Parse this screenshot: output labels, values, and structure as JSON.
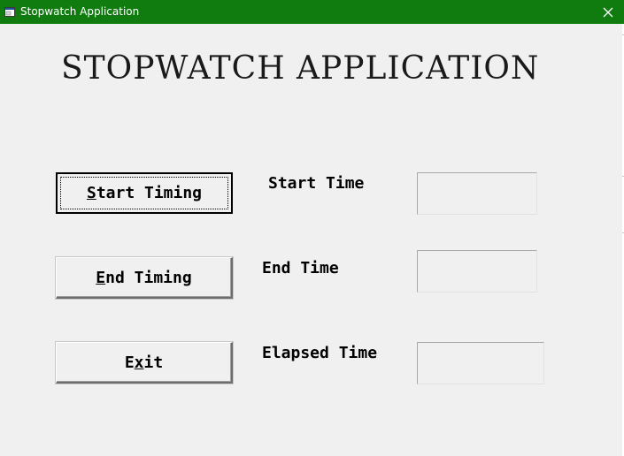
{
  "window": {
    "title": "Stopwatch Application",
    "titlebar_color": "#107c10",
    "icon": "app-window-icon",
    "close_icon": "close-icon"
  },
  "heading": "STOPWATCH APPLICATION",
  "buttons": {
    "start": {
      "label_access_key": "S",
      "label_rest": "tart Timing"
    },
    "end": {
      "label_access_key": "E",
      "label_rest": "nd Timing"
    },
    "exit": {
      "label_before": "E",
      "label_access_key": "x",
      "label_after": "it"
    }
  },
  "labels": {
    "start_time": "Start Time",
    "end_time": "End Time",
    "elapsed_time": "Elapsed Time"
  },
  "fields": {
    "start_time_value": "",
    "end_time_value": "",
    "elapsed_time_value": ""
  }
}
